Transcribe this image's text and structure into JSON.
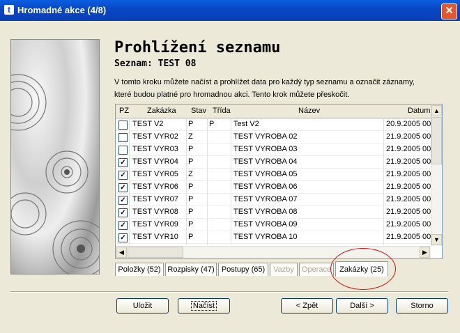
{
  "window": {
    "title": "Hromadné akce (4/8)",
    "app_icon": "t",
    "close": "✕"
  },
  "heading": "Prohlížení seznamu",
  "subheading": "Seznam: TEST 08",
  "description": [
    "V tomto kroku můžete načíst a prohlížet data pro každý typ seznamu a označit záznamy,",
    "které budou platné pro hromadnou akci. Tento krok můžete přeskočit."
  ],
  "grid": {
    "columns": [
      "PZ",
      "Zakázka",
      "Stav",
      "Třída",
      "Název",
      "Datum"
    ],
    "rows": [
      {
        "checked": false,
        "zakazka": "TEST V2",
        "stav": "P",
        "trida": "P",
        "nazev": "Test V2",
        "datum": "20.9.2005 00"
      },
      {
        "checked": false,
        "zakazka": "TEST VYR02",
        "stav": "Z",
        "trida": "",
        "nazev": "TEST VYROBA 02",
        "datum": "21.9.2005 00"
      },
      {
        "checked": false,
        "zakazka": "TEST VYR03",
        "stav": "P",
        "trida": "",
        "nazev": "TEST VYROBA 03",
        "datum": "21.9.2005 00"
      },
      {
        "checked": true,
        "zakazka": "TEST VYR04",
        "stav": "P",
        "trida": "",
        "nazev": "TEST VYROBA 04",
        "datum": "21.9.2005 00"
      },
      {
        "checked": true,
        "zakazka": "TEST VYR05",
        "stav": "Z",
        "trida": "",
        "nazev": "TEST VYROBA 05",
        "datum": "21.9.2005 00"
      },
      {
        "checked": true,
        "zakazka": "TEST VYR06",
        "stav": "P",
        "trida": "",
        "nazev": "TEST VYROBA 06",
        "datum": "21.9.2005 00"
      },
      {
        "checked": true,
        "zakazka": "TEST VYR07",
        "stav": "P",
        "trida": "",
        "nazev": "TEST VYROBA 07",
        "datum": "21.9.2005 00"
      },
      {
        "checked": true,
        "zakazka": "TEST VYR08",
        "stav": "P",
        "trida": "",
        "nazev": "TEST VYROBA 08",
        "datum": "21.9.2005 00"
      },
      {
        "checked": true,
        "zakazka": "TEST VYR09",
        "stav": "P",
        "trida": "",
        "nazev": "TEST VYROBA 09",
        "datum": "21.9.2005 00"
      },
      {
        "checked": true,
        "zakazka": "TEST VYR10",
        "stav": "P",
        "trida": "",
        "nazev": "TEST VYROBA 10",
        "datum": "21.9.2005 00"
      }
    ]
  },
  "tabs": [
    {
      "label": "Položky (52)",
      "state": "normal"
    },
    {
      "label": "Rozpisky (47)",
      "state": "normal"
    },
    {
      "label": "Postupy (65)",
      "state": "normal"
    },
    {
      "label": "Vazby",
      "state": "disabled"
    },
    {
      "label": "Operace",
      "state": "disabled"
    },
    {
      "label": "Zakázky (25)",
      "state": "active"
    }
  ],
  "buttons": {
    "save": "Uložit",
    "load": "Načíst",
    "back": "< Zpět",
    "next": "Další >",
    "cancel": "Storno"
  },
  "colors": {
    "titlebar": "#0846c4",
    "annotation_circle": "#d01010",
    "dialog_bg": "#ece9d8"
  }
}
